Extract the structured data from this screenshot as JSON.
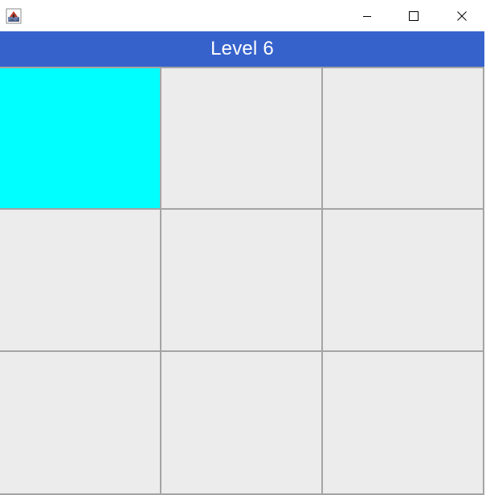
{
  "window": {
    "icon": "java-app-icon",
    "controls": {
      "minimize_icon": "minimize-icon",
      "maximize_icon": "maximize-icon",
      "close_icon": "close-icon"
    }
  },
  "header": {
    "title": "Level 6",
    "background_color": "#3662cc",
    "text_color": "#ffffff"
  },
  "grid": {
    "rows": 3,
    "columns": 3,
    "cell_color": "#ececec",
    "active_color": "#00ffff",
    "line_color": "#a4a4a4",
    "cells": [
      {
        "row": 1,
        "col": 1,
        "active": true
      },
      {
        "row": 1,
        "col": 2,
        "active": false
      },
      {
        "row": 1,
        "col": 3,
        "active": false
      },
      {
        "row": 2,
        "col": 1,
        "active": false
      },
      {
        "row": 2,
        "col": 2,
        "active": false
      },
      {
        "row": 2,
        "col": 3,
        "active": false
      },
      {
        "row": 3,
        "col": 1,
        "active": false
      },
      {
        "row": 3,
        "col": 2,
        "active": false
      },
      {
        "row": 3,
        "col": 3,
        "active": false
      }
    ]
  }
}
